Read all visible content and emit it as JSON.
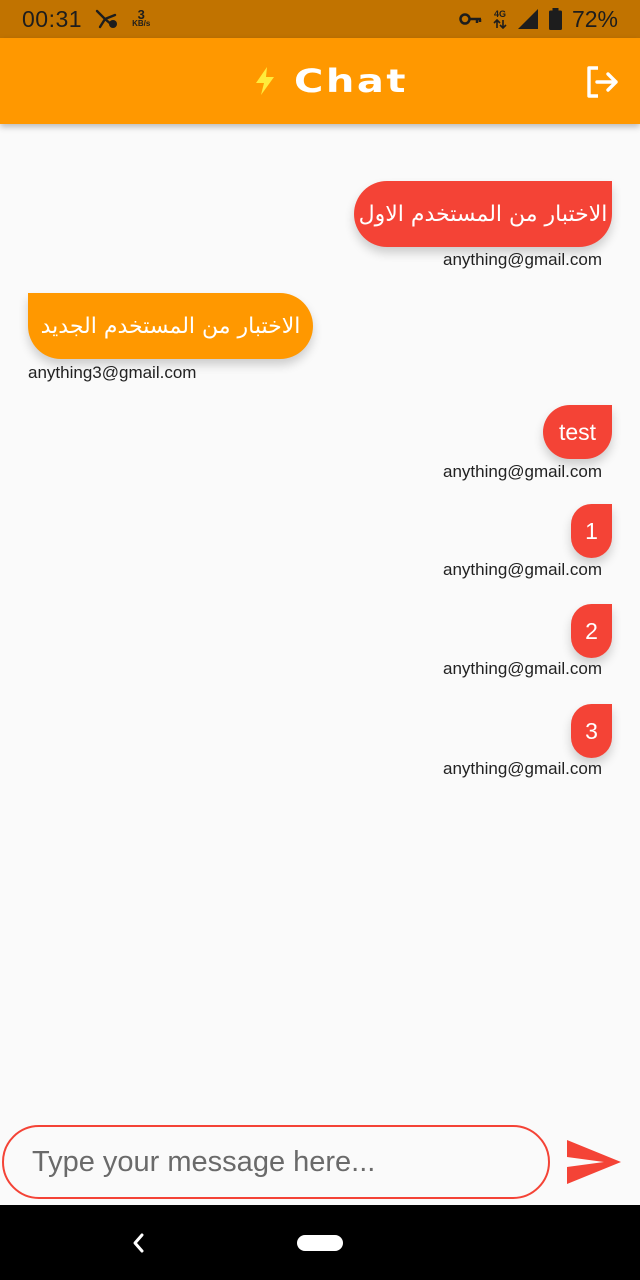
{
  "status_bar": {
    "time": "00:31",
    "speed_value": "3",
    "speed_unit": "KB/s",
    "network": "4G",
    "battery": "72%"
  },
  "app_bar": {
    "title": "Chat",
    "title_icon": "lightning-bolt-icon",
    "action_icon": "logout-icon",
    "color": "#ff9800"
  },
  "messages": [
    {
      "text": "الاختبار من المستخدم الاول",
      "sender": "anything@gmail.com",
      "side": "right"
    },
    {
      "text": "الاختبار من المستخدم الجديد",
      "sender": "anything3@gmail.com",
      "side": "left"
    },
    {
      "text": "test",
      "sender": "anything@gmail.com",
      "side": "right"
    },
    {
      "text": "1",
      "sender": "anything@gmail.com",
      "side": "right"
    },
    {
      "text": "2",
      "sender": "anything@gmail.com",
      "side": "right"
    },
    {
      "text": "3",
      "sender": "anything@gmail.com",
      "side": "right"
    }
  ],
  "composer": {
    "placeholder": "Type your message here...",
    "send_icon": "send-icon"
  },
  "colors": {
    "own_bubble": "#f44336",
    "other_bubble": "#ff9800"
  }
}
